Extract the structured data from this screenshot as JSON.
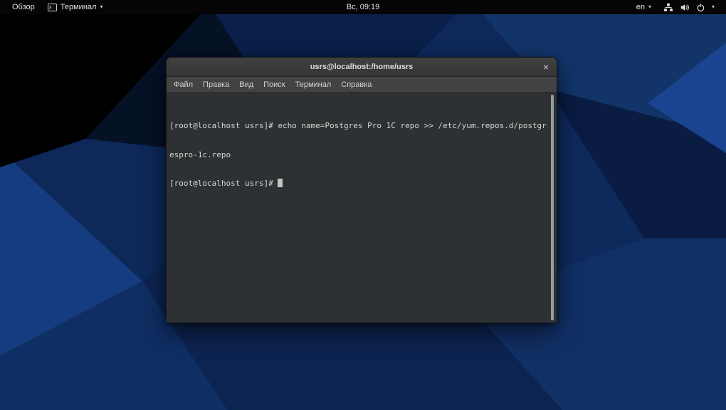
{
  "colors": {
    "wallpaper_base": "#0d2555",
    "topbar_bg": "#050505",
    "titlebar_bg": "#3b3b3b",
    "menubar_bg": "#434343",
    "terminal_bg": "#2d3134",
    "terminal_fg": "#d3d7cf"
  },
  "topbar": {
    "activities_label": "Обзор",
    "app_menu": {
      "label": "Терминал",
      "icon": "terminal-icon",
      "chevron": "▾"
    },
    "clock": "Вс, 09:19",
    "status": {
      "keyboard_layout": "en",
      "keyboard_chevron": "▾",
      "icons": [
        "network-icon",
        "volume-icon",
        "power-icon"
      ],
      "menu_chevron": "▾"
    }
  },
  "window": {
    "title": "usrs@localhost:/home/usrs",
    "close_label": "×",
    "menu": [
      "Файл",
      "Правка",
      "Вид",
      "Поиск",
      "Терминал",
      "Справка"
    ],
    "terminal": {
      "lines": [
        "[root@localhost usrs]# echo name=Postgres Pro 1C repo >> /etc/yum.repos.d/postgr",
        "espro-1c.repo"
      ],
      "prompt": "[root@localhost usrs]# "
    }
  }
}
